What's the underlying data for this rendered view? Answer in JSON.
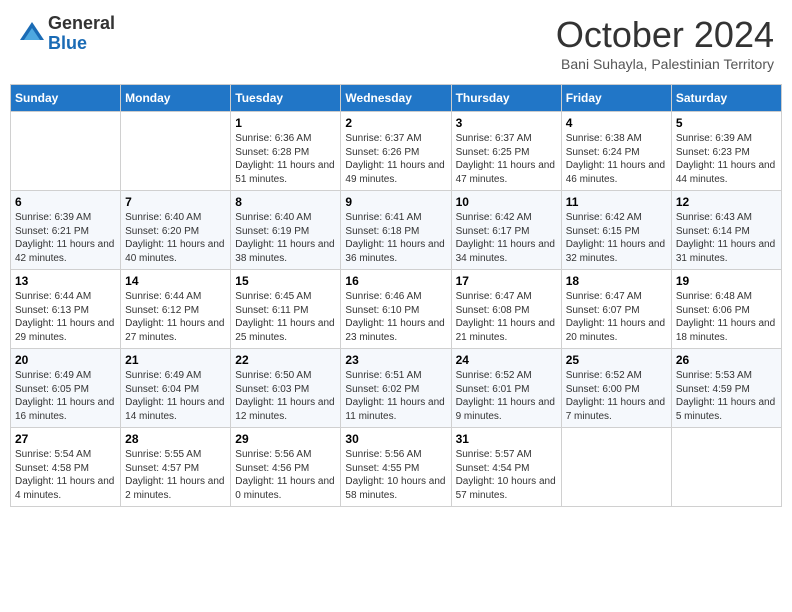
{
  "logo": {
    "general": "General",
    "blue": "Blue"
  },
  "header": {
    "month": "October 2024",
    "location": "Bani Suhayla, Palestinian Territory"
  },
  "weekdays": [
    "Sunday",
    "Monday",
    "Tuesday",
    "Wednesday",
    "Thursday",
    "Friday",
    "Saturday"
  ],
  "weeks": [
    [
      {
        "day": "",
        "info": ""
      },
      {
        "day": "",
        "info": ""
      },
      {
        "day": "1",
        "info": "Sunrise: 6:36 AM\nSunset: 6:28 PM\nDaylight: 11 hours and 51 minutes."
      },
      {
        "day": "2",
        "info": "Sunrise: 6:37 AM\nSunset: 6:26 PM\nDaylight: 11 hours and 49 minutes."
      },
      {
        "day": "3",
        "info": "Sunrise: 6:37 AM\nSunset: 6:25 PM\nDaylight: 11 hours and 47 minutes."
      },
      {
        "day": "4",
        "info": "Sunrise: 6:38 AM\nSunset: 6:24 PM\nDaylight: 11 hours and 46 minutes."
      },
      {
        "day": "5",
        "info": "Sunrise: 6:39 AM\nSunset: 6:23 PM\nDaylight: 11 hours and 44 minutes."
      }
    ],
    [
      {
        "day": "6",
        "info": "Sunrise: 6:39 AM\nSunset: 6:21 PM\nDaylight: 11 hours and 42 minutes."
      },
      {
        "day": "7",
        "info": "Sunrise: 6:40 AM\nSunset: 6:20 PM\nDaylight: 11 hours and 40 minutes."
      },
      {
        "day": "8",
        "info": "Sunrise: 6:40 AM\nSunset: 6:19 PM\nDaylight: 11 hours and 38 minutes."
      },
      {
        "day": "9",
        "info": "Sunrise: 6:41 AM\nSunset: 6:18 PM\nDaylight: 11 hours and 36 minutes."
      },
      {
        "day": "10",
        "info": "Sunrise: 6:42 AM\nSunset: 6:17 PM\nDaylight: 11 hours and 34 minutes."
      },
      {
        "day": "11",
        "info": "Sunrise: 6:42 AM\nSunset: 6:15 PM\nDaylight: 11 hours and 32 minutes."
      },
      {
        "day": "12",
        "info": "Sunrise: 6:43 AM\nSunset: 6:14 PM\nDaylight: 11 hours and 31 minutes."
      }
    ],
    [
      {
        "day": "13",
        "info": "Sunrise: 6:44 AM\nSunset: 6:13 PM\nDaylight: 11 hours and 29 minutes."
      },
      {
        "day": "14",
        "info": "Sunrise: 6:44 AM\nSunset: 6:12 PM\nDaylight: 11 hours and 27 minutes."
      },
      {
        "day": "15",
        "info": "Sunrise: 6:45 AM\nSunset: 6:11 PM\nDaylight: 11 hours and 25 minutes."
      },
      {
        "day": "16",
        "info": "Sunrise: 6:46 AM\nSunset: 6:10 PM\nDaylight: 11 hours and 23 minutes."
      },
      {
        "day": "17",
        "info": "Sunrise: 6:47 AM\nSunset: 6:08 PM\nDaylight: 11 hours and 21 minutes."
      },
      {
        "day": "18",
        "info": "Sunrise: 6:47 AM\nSunset: 6:07 PM\nDaylight: 11 hours and 20 minutes."
      },
      {
        "day": "19",
        "info": "Sunrise: 6:48 AM\nSunset: 6:06 PM\nDaylight: 11 hours and 18 minutes."
      }
    ],
    [
      {
        "day": "20",
        "info": "Sunrise: 6:49 AM\nSunset: 6:05 PM\nDaylight: 11 hours and 16 minutes."
      },
      {
        "day": "21",
        "info": "Sunrise: 6:49 AM\nSunset: 6:04 PM\nDaylight: 11 hours and 14 minutes."
      },
      {
        "day": "22",
        "info": "Sunrise: 6:50 AM\nSunset: 6:03 PM\nDaylight: 11 hours and 12 minutes."
      },
      {
        "day": "23",
        "info": "Sunrise: 6:51 AM\nSunset: 6:02 PM\nDaylight: 11 hours and 11 minutes."
      },
      {
        "day": "24",
        "info": "Sunrise: 6:52 AM\nSunset: 6:01 PM\nDaylight: 11 hours and 9 minutes."
      },
      {
        "day": "25",
        "info": "Sunrise: 6:52 AM\nSunset: 6:00 PM\nDaylight: 11 hours and 7 minutes."
      },
      {
        "day": "26",
        "info": "Sunrise: 5:53 AM\nSunset: 4:59 PM\nDaylight: 11 hours and 5 minutes."
      }
    ],
    [
      {
        "day": "27",
        "info": "Sunrise: 5:54 AM\nSunset: 4:58 PM\nDaylight: 11 hours and 4 minutes."
      },
      {
        "day": "28",
        "info": "Sunrise: 5:55 AM\nSunset: 4:57 PM\nDaylight: 11 hours and 2 minutes."
      },
      {
        "day": "29",
        "info": "Sunrise: 5:56 AM\nSunset: 4:56 PM\nDaylight: 11 hours and 0 minutes."
      },
      {
        "day": "30",
        "info": "Sunrise: 5:56 AM\nSunset: 4:55 PM\nDaylight: 10 hours and 58 minutes."
      },
      {
        "day": "31",
        "info": "Sunrise: 5:57 AM\nSunset: 4:54 PM\nDaylight: 10 hours and 57 minutes."
      },
      {
        "day": "",
        "info": ""
      },
      {
        "day": "",
        "info": ""
      }
    ]
  ]
}
